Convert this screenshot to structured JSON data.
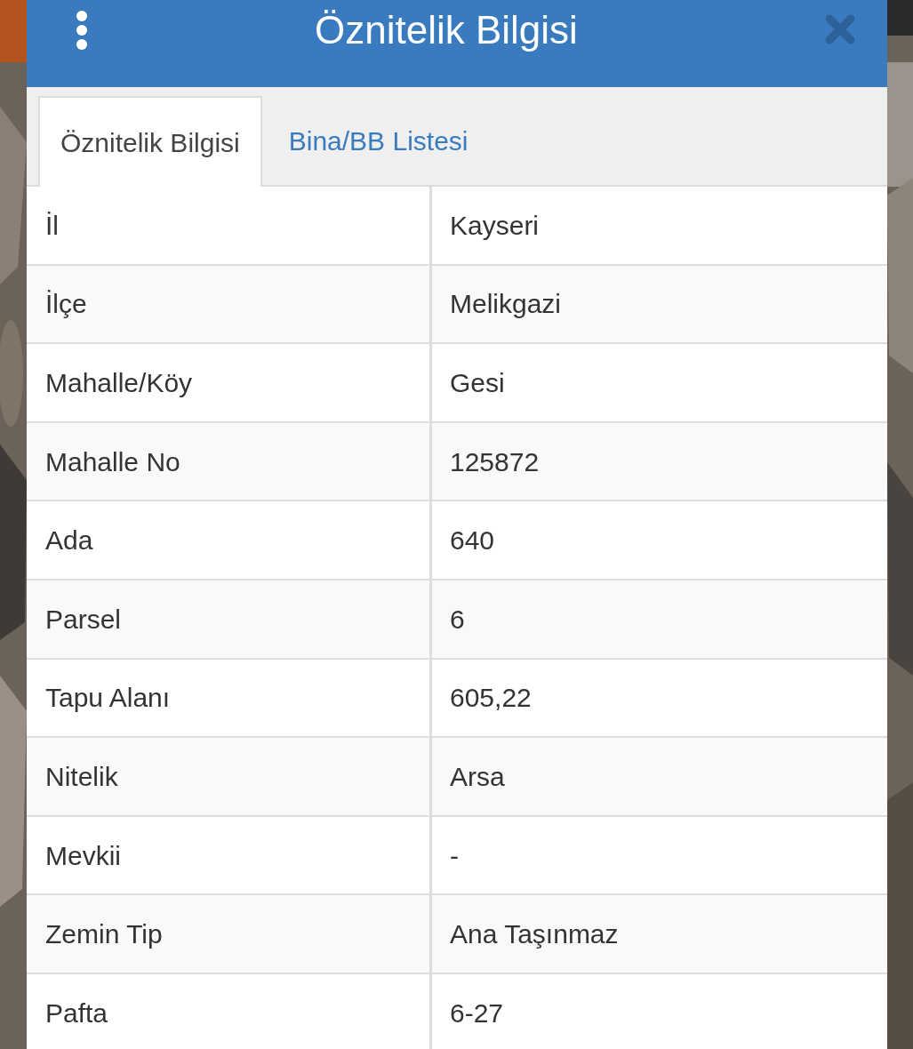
{
  "dialog": {
    "title": "Öznitelik Bilgisi"
  },
  "tabs": [
    {
      "label": "Öznitelik Bilgisi",
      "selected": true
    },
    {
      "label": "Bina/BB Listesi",
      "selected": false
    }
  ],
  "table": {
    "rows": [
      {
        "label": "İl",
        "value": "Kayseri"
      },
      {
        "label": "İlçe",
        "value": "Melikgazi"
      },
      {
        "label": "Mahalle/Köy",
        "value": "Gesi"
      },
      {
        "label": "Mahalle No",
        "value": "125872"
      },
      {
        "label": "Ada",
        "value": "640"
      },
      {
        "label": "Parsel",
        "value": "6"
      },
      {
        "label": "Tapu Alanı",
        "value": "605,22"
      },
      {
        "label": "Nitelik",
        "value": "Arsa"
      },
      {
        "label": "Mevkii",
        "value": "-"
      },
      {
        "label": "Zemin Tip",
        "value": "Ana Taşınmaz"
      },
      {
        "label": "Pafta",
        "value": "6-27"
      }
    ]
  }
}
